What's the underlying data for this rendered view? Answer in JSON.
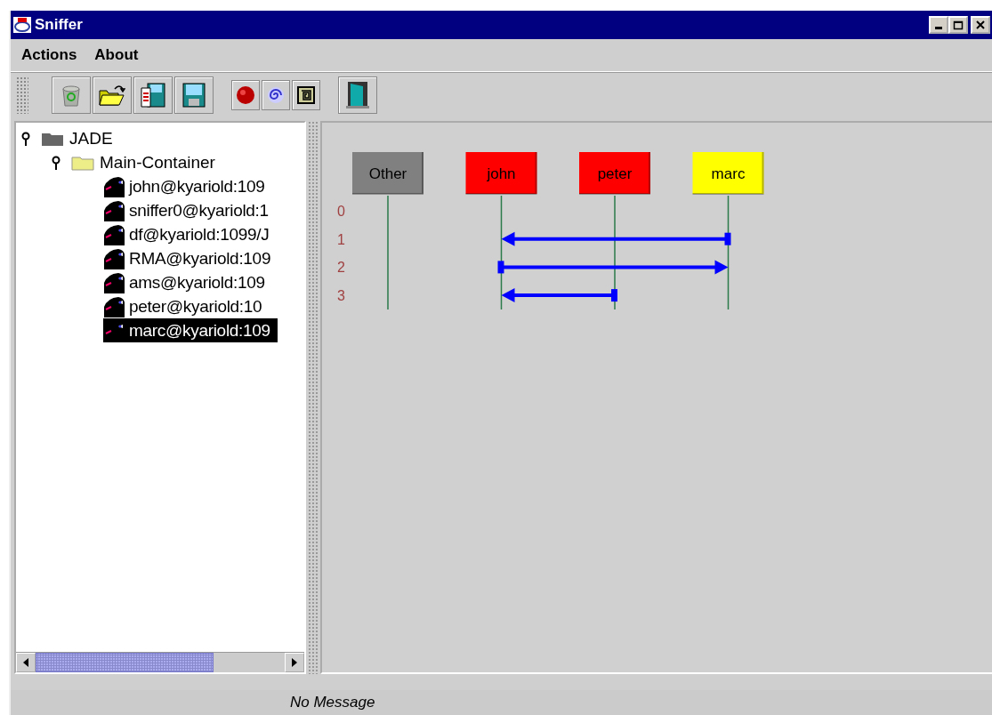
{
  "window": {
    "title": "Sniffer"
  },
  "menu": [
    "Actions",
    "About"
  ],
  "toolbar": [
    {
      "kind": "trash"
    },
    {
      "kind": "open"
    },
    {
      "kind": "saveas"
    },
    {
      "kind": "save"
    },
    {
      "kind": "gap"
    },
    {
      "kind": "record"
    },
    {
      "kind": "spiral"
    },
    {
      "kind": "square"
    },
    {
      "kind": "gap"
    },
    {
      "kind": "exit"
    }
  ],
  "tree": {
    "label": "JADE",
    "expanded": true,
    "children": [
      {
        "label": "Main-Container",
        "expanded": true,
        "children": [
          {
            "label": "john@kyariold:109",
            "selected": false
          },
          {
            "label": "sniffer0@kyariold:1",
            "selected": false
          },
          {
            "label": "df@kyariold:1099/J",
            "selected": false
          },
          {
            "label": "RMA@kyariold:109",
            "selected": false
          },
          {
            "label": "ams@kyariold:109",
            "selected": false
          },
          {
            "label": "peter@kyariold:10",
            "selected": false
          },
          {
            "label": "marc@kyariold:109",
            "selected": true
          }
        ]
      }
    ]
  },
  "diagram": {
    "agents": [
      {
        "name": "Other",
        "color": "#808080"
      },
      {
        "name": "john",
        "color": "#ff0000"
      },
      {
        "name": "peter",
        "color": "#ff0000"
      },
      {
        "name": "marc",
        "color": "#ffff00"
      }
    ],
    "rows": [
      {
        "label": "0"
      },
      {
        "label": "1",
        "cells": [
          {
            "kind": "none"
          },
          {
            "kind": "target"
          },
          {
            "kind": "none"
          },
          {
            "kind": "source"
          }
        ]
      },
      {
        "label": "2",
        "cells": [
          {
            "kind": "none"
          },
          {
            "kind": "source"
          },
          {
            "kind": "none"
          },
          {
            "kind": "target"
          }
        ]
      },
      {
        "label": "3",
        "cells": [
          {
            "kind": "none"
          },
          {
            "kind": "target"
          },
          {
            "kind": "source"
          },
          {
            "kind": "none"
          }
        ]
      }
    ]
  },
  "status_bar": "No Message"
}
